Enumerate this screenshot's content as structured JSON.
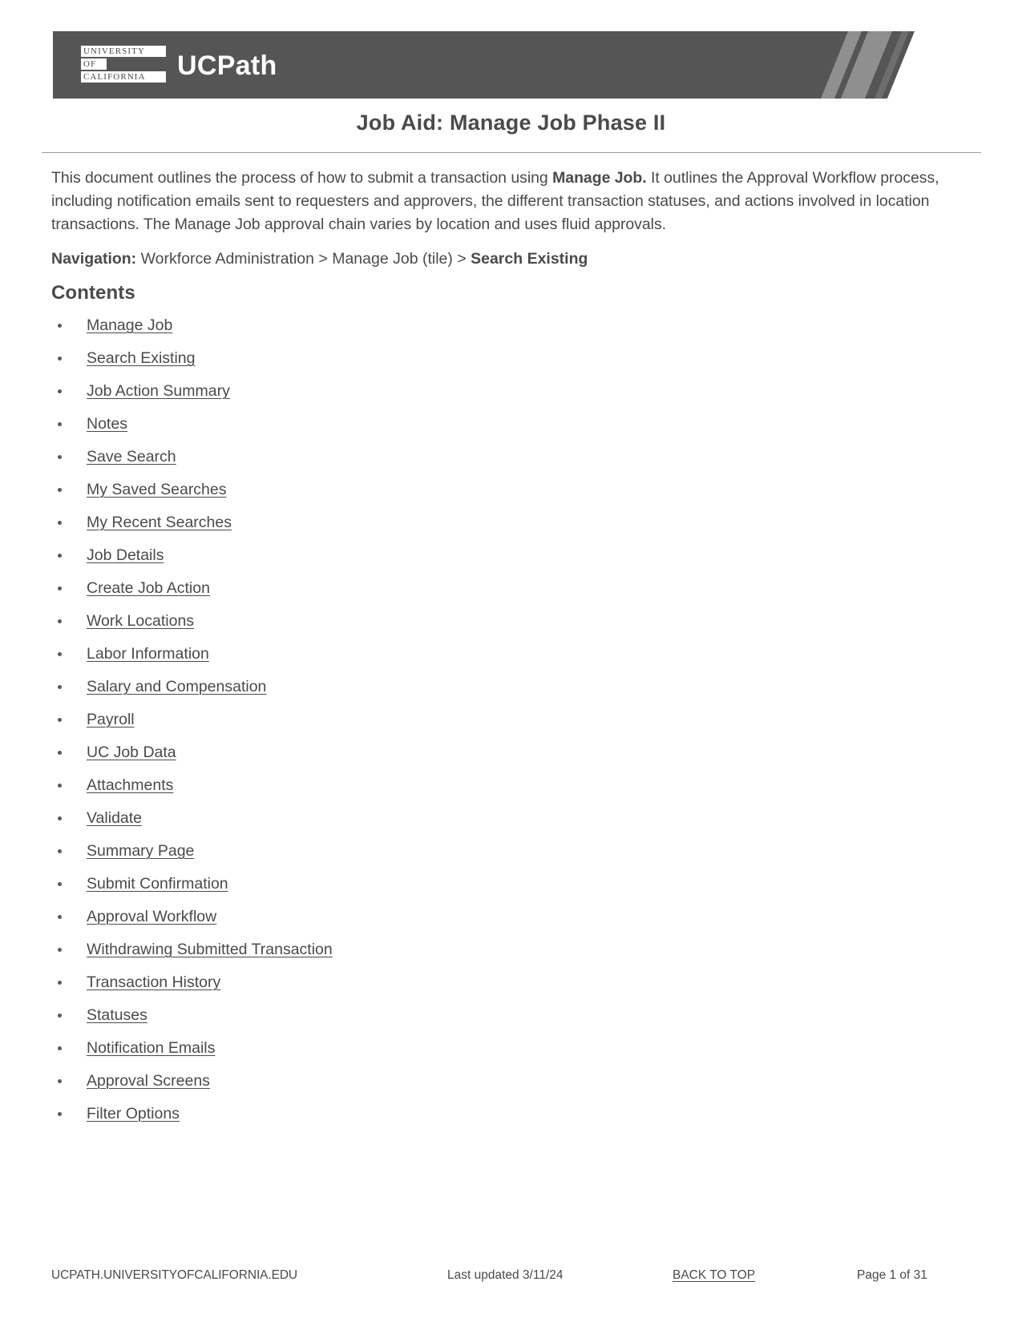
{
  "header": {
    "logo_line_1": "UNIVERSITY",
    "logo_line_2": "OF",
    "logo_line_3": "CALIFORNIA",
    "brand": "UCPath",
    "banner_color": "#555555",
    "slash_color": "#8f8f8f"
  },
  "title": "Job Aid: Manage Job Phase II",
  "intro": {
    "part_1": "This document outlines the process of how to submit a transaction using ",
    "bold_1": "Manage Job.",
    "part_2": " It outlines the Approval Workflow process, including notification emails sent to requesters and approvers, the different transaction statuses, and actions involved in location transactions. The Manage Job approval chain varies by location and uses fluid approvals."
  },
  "navigation": {
    "label": "Navigation:",
    "path": " Workforce Administration > Manage Job (tile) > ",
    "last": "Search Existing"
  },
  "contents": {
    "heading": "Contents",
    "items": [
      {
        "label": "Manage Job"
      },
      {
        "label": "Search Existing"
      },
      {
        "label": "Job Action Summary"
      },
      {
        "label": "Notes"
      },
      {
        "label": "Save Search"
      },
      {
        "label": "My Saved Searches"
      },
      {
        "label": "My Recent Searches"
      },
      {
        "label": "Job Details"
      },
      {
        "label": "Create Job Action"
      },
      {
        "label": "Work Locations"
      },
      {
        "label": "Labor Information"
      },
      {
        "label": "Salary and Compensation"
      },
      {
        "label": "Payroll"
      },
      {
        "label": "UC Job Data"
      },
      {
        "label": "Attachments"
      },
      {
        "label": "Validate"
      },
      {
        "label": "Summary Page"
      },
      {
        "label": "Submit Confirmation"
      },
      {
        "label": "Approval Workflow"
      },
      {
        "label": "Withdrawing Submitted Transaction"
      },
      {
        "label": "Transaction History"
      },
      {
        "label": "Statuses"
      },
      {
        "label": "Notification Emails"
      },
      {
        "label": "Approval Screens"
      },
      {
        "label": "Filter Options"
      }
    ]
  },
  "footer": {
    "site": "UCPATH.UNIVERSITYOFCALIFORNIA.EDU",
    "updated": "Last updated 3/11/24",
    "back_to_top": "BACK TO TOP",
    "page": "Page 1 of 31"
  }
}
